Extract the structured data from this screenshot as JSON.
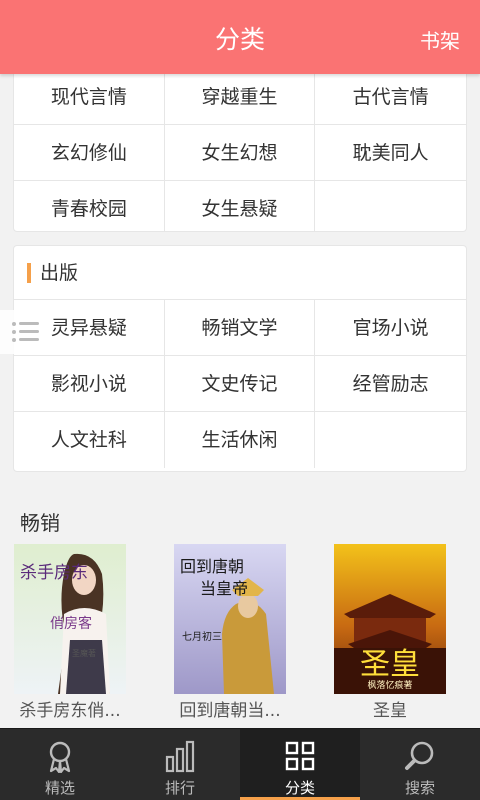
{
  "header": {
    "title": "分类",
    "bookshelf": "书架"
  },
  "category_group_1": {
    "items": [
      "现代言情",
      "穿越重生",
      "古代言情",
      "玄幻修仙",
      "女生幻想",
      "耽美同人",
      "青春校园",
      "女生悬疑",
      ""
    ]
  },
  "category_group_2": {
    "title": "出版",
    "items": [
      "灵异悬疑",
      "畅销文学",
      "官场小说",
      "影视小说",
      "文史传记",
      "经管励志",
      "人文社科",
      "生活休闲",
      ""
    ]
  },
  "bestseller": {
    "title": "畅销",
    "books": [
      {
        "name": "杀手房东俏...",
        "cover_text": [
          "杀手房东",
          "俏房客"
        ],
        "cover_author": "圣魔著"
      },
      {
        "name": "回到唐朝当...",
        "cover_text": [
          "回到唐朝",
          "当皇帝"
        ],
        "cover_author": "七月初三"
      },
      {
        "name": "圣皇",
        "cover_text": [
          "圣皇"
        ],
        "cover_author": "枫落忆痕著"
      }
    ]
  },
  "tabbar": {
    "tabs": [
      {
        "label": "精选",
        "icon": "ribbon-icon"
      },
      {
        "label": "排行",
        "icon": "bar-chart-icon"
      },
      {
        "label": "分类",
        "icon": "grid-icon"
      },
      {
        "label": "搜索",
        "icon": "search-icon"
      }
    ],
    "active_index": 2
  },
  "colors": {
    "header": "#fa7373",
    "accent": "#f5a04a",
    "tabbar": "#2b2b2b"
  }
}
